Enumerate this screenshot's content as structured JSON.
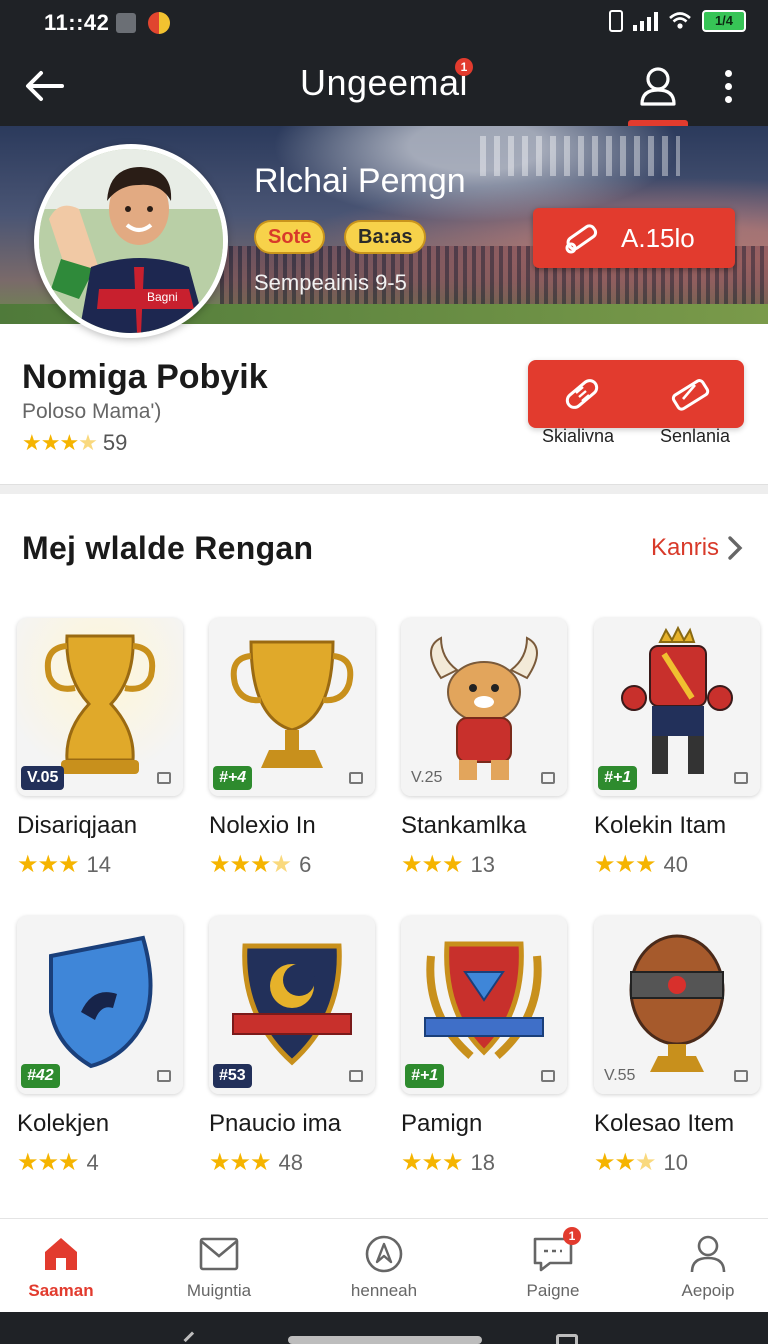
{
  "status_bar": {
    "time": "11::42",
    "battery": "1/4"
  },
  "app_bar": {
    "title": "Ungeemai",
    "title_badge": "1"
  },
  "banner": {
    "name": "Rlchai Pemgn",
    "tags": [
      "Sote",
      "Ba:as"
    ],
    "subtitle": "Sempeainis 9-5",
    "action_label": "A.15lo"
  },
  "profile": {
    "name": "Nomiga  Pobyik",
    "subtitle": "Poloso Mama')",
    "stars": 3.5,
    "rating_count": "59",
    "actions": [
      {
        "label": "Skialivna",
        "icon": "bandage-icon"
      },
      {
        "label": "Senlania",
        "icon": "eraser-icon"
      }
    ]
  },
  "section": {
    "title": "Mej wlalde Rengan",
    "link_label": "Kanris"
  },
  "items": [
    {
      "name": "Disariqjaan",
      "badge": "V.05",
      "badge_style": "navy",
      "icon": "trophy-icon",
      "stars": 3,
      "count": "14"
    },
    {
      "name": "Nolexio In",
      "badge": "#+4",
      "badge_style": "green",
      "icon": "cup-icon",
      "stars": 3.5,
      "count": "6"
    },
    {
      "name": "Stankamlka",
      "badge": "V.25",
      "badge_style": "plain",
      "icon": "mascot-icon",
      "stars": 3,
      "count": "13"
    },
    {
      "name": "Kolekin Itam",
      "badge": "#+1",
      "badge_style": "green",
      "icon": "boxer-king-icon",
      "stars": 3,
      "count": "40"
    },
    {
      "name": "Kolekjen",
      "badge": "#42",
      "badge_style": "green",
      "icon": "blue-shield-icon",
      "stars": 3,
      "count": "4"
    },
    {
      "name": "Pnaucio ima",
      "badge": "#53",
      "badge_style": "navy",
      "icon": "crest-icon",
      "stars": 3,
      "count": "48"
    },
    {
      "name": "Pamign",
      "badge": "#+1",
      "badge_style": "green",
      "icon": "laurel-shield-icon",
      "stars": 3,
      "count": "18"
    },
    {
      "name": "Kolesao Item",
      "badge": "V.55",
      "badge_style": "plain",
      "icon": "urn-icon",
      "stars": 2.5,
      "count": "10"
    }
  ],
  "bottom_nav": [
    {
      "label": "Saaman",
      "icon": "home-icon",
      "active": true
    },
    {
      "label": "Muigntia",
      "icon": "mail-icon",
      "active": false
    },
    {
      "label": "henneah",
      "icon": "compass-icon",
      "active": false
    },
    {
      "label": "Paigne",
      "icon": "chat-icon",
      "active": false,
      "badge": "1"
    },
    {
      "label": "Aepoip",
      "icon": "person-icon",
      "active": false
    }
  ],
  "colors": {
    "accent": "#e23b2e",
    "bar": "#1f2226",
    "star": "#f5b400"
  }
}
